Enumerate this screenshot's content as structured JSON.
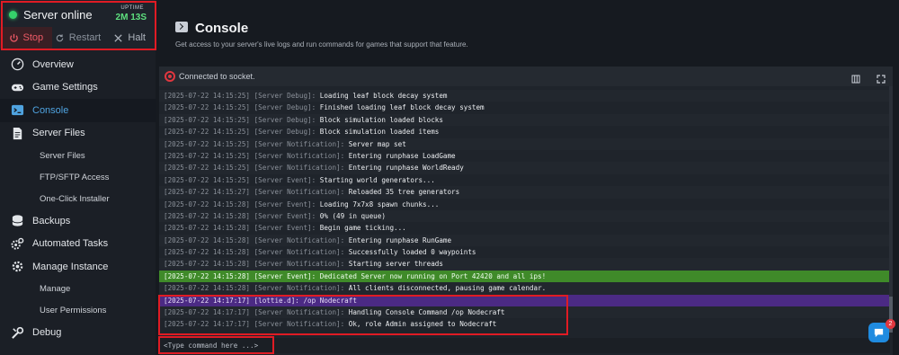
{
  "server": {
    "status_text": "Server online",
    "uptime_label": "UPTIME",
    "uptime_value": "2M 13S",
    "power": {
      "stop": "Stop",
      "restart": "Restart",
      "halt": "Halt"
    }
  },
  "nav": {
    "overview": "Overview",
    "game_settings": "Game Settings",
    "console": "Console",
    "server_files": "Server Files",
    "files_sub": [
      "Server Files",
      "FTP/SFTP Access",
      "One-Click Installer"
    ],
    "backups": "Backups",
    "automated_tasks": "Automated Tasks",
    "manage_instance": "Manage Instance",
    "manage_sub": [
      "Manage",
      "User Permissions"
    ],
    "debug": "Debug"
  },
  "header": {
    "title": "Console",
    "subtitle": "Get access to your server's live logs and run commands for games that support that feature."
  },
  "console": {
    "socket_status": "Connected to socket.",
    "input_placeholder": "<Type command here ...>",
    "lines": [
      {
        "ts": "[2025-07-22 14:15:25]",
        "src": "[Server Debug]:",
        "msg": "Loading leaf block decay system",
        "kind": "normal"
      },
      {
        "ts": "[2025-07-22 14:15:25]",
        "src": "[Server Debug]:",
        "msg": "Finished loading leaf block decay system",
        "kind": "normal"
      },
      {
        "ts": "[2025-07-22 14:15:25]",
        "src": "[Server Debug]:",
        "msg": "Block simulation loaded blocks",
        "kind": "normal"
      },
      {
        "ts": "[2025-07-22 14:15:25]",
        "src": "[Server Debug]:",
        "msg": "Block simulation loaded items",
        "kind": "normal"
      },
      {
        "ts": "[2025-07-22 14:15:25]",
        "src": "[Server Notification]:",
        "msg": "Server map set",
        "kind": "normal"
      },
      {
        "ts": "[2025-07-22 14:15:25]",
        "src": "[Server Notification]:",
        "msg": "Entering runphase LoadGame",
        "kind": "normal"
      },
      {
        "ts": "[2025-07-22 14:15:25]",
        "src": "[Server Notification]:",
        "msg": "Entering runphase WorldReady",
        "kind": "normal"
      },
      {
        "ts": "[2025-07-22 14:15:25]",
        "src": "[Server Event]:",
        "msg": "Starting world generators...",
        "kind": "normal"
      },
      {
        "ts": "[2025-07-22 14:15:27]",
        "src": "[Server Notification]:",
        "msg": "Reloaded 35 tree generators",
        "kind": "normal"
      },
      {
        "ts": "[2025-07-22 14:15:28]",
        "src": "[Server Event]:",
        "msg": "Loading 7x7x8 spawn chunks...",
        "kind": "normal"
      },
      {
        "ts": "[2025-07-22 14:15:28]",
        "src": "[Server Event]:",
        "msg": "0% (49 in queue)",
        "kind": "normal"
      },
      {
        "ts": "[2025-07-22 14:15:28]",
        "src": "[Server Event]:",
        "msg": "Begin game ticking...",
        "kind": "normal"
      },
      {
        "ts": "[2025-07-22 14:15:28]",
        "src": "[Server Notification]:",
        "msg": "Entering runphase RunGame",
        "kind": "normal"
      },
      {
        "ts": "[2025-07-22 14:15:28]",
        "src": "[Server Notification]:",
        "msg": "Successfully loaded 0 waypoints",
        "kind": "normal"
      },
      {
        "ts": "[2025-07-22 14:15:28]",
        "src": "[Server Notification]:",
        "msg": "Starting server threads",
        "kind": "normal"
      },
      {
        "ts": "[2025-07-22 14:15:28]",
        "src": "[Server Event]:",
        "msg": "Dedicated Server now running on Port 42420 and all ips!",
        "kind": "ok"
      },
      {
        "ts": "[2025-07-22 14:15:28]",
        "src": "[Server Notification]:",
        "msg": "All clients disconnected, pausing game calendar.",
        "kind": "normal"
      },
      {
        "ts": "[2025-07-22 14:17:17]",
        "src": "[lottie.d]:",
        "msg": "/op Nodecraft",
        "kind": "cmd"
      },
      {
        "ts": "[2025-07-22 14:17:17]",
        "src": "[Server Notification]:",
        "msg": "Handling Console Command /op Nodecraft",
        "kind": "normal"
      },
      {
        "ts": "[2025-07-22 14:17:17]",
        "src": "[Server Notification]:",
        "msg": "Ok, role Admin assigned to Nodecraft",
        "kind": "normal"
      }
    ]
  },
  "chat": {
    "badge_count": "2"
  },
  "colors": {
    "accent": "#4fa3e0",
    "online": "#35d36b",
    "highlight_green": "#3f8a29",
    "highlight_purple": "#4b2a84",
    "annotation_red": "#e01b24"
  }
}
